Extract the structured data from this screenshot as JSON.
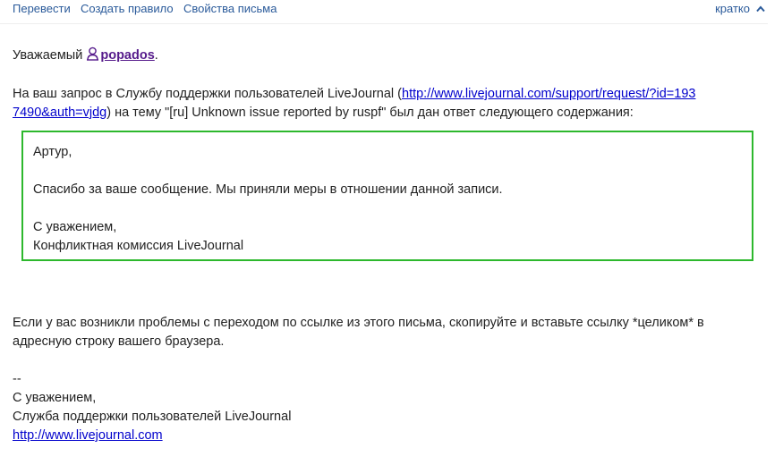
{
  "toolbar": {
    "translate": "Перевести",
    "create_rule": "Создать правило",
    "message_properties": "Свойства письма",
    "brief": "кратко"
  },
  "email": {
    "greeting_prefix": "Уважаемый",
    "username": "popados",
    "greeting_suffix": ".",
    "intro_part1": "На ваш запрос в Службу поддержки пользователей LiveJournal (",
    "request_link_part1": "http://www.livejournal.com/support/request/?id=193",
    "request_link_part2": "7490&auth=vjdg",
    "intro_part2": ") на тему \"[ru] Unknown issue reported by ruspf\" был дан ответ следующего содержания:",
    "quote": {
      "salutation": "Артур,",
      "message": "Спасибо за ваше сообщение. Мы приняли меры в отношении данной записи.",
      "regards": "С уважением,",
      "signature": "Конфликтная комиссия LiveJournal"
    },
    "problem_note_line1": "Если у вас возникли проблемы с переходом по ссылке из этого письма, скопируйте и вставьте ссылку *целиком* в",
    "problem_note_line2": "адресную строку вашего браузера.",
    "sig_separator": "--",
    "sig_regards": "С уважением,",
    "sig_team": "Служба поддержки пользователей LiveJournal",
    "sig_link": "http://www.livejournal.com"
  },
  "colors": {
    "toolbar_link": "#2a5a9a",
    "link": "#0000cc",
    "user_link": "#551a8b",
    "quote_border": "#2db82d"
  },
  "icons": {
    "user": "user-icon",
    "chevron": "chevron-up-icon"
  }
}
